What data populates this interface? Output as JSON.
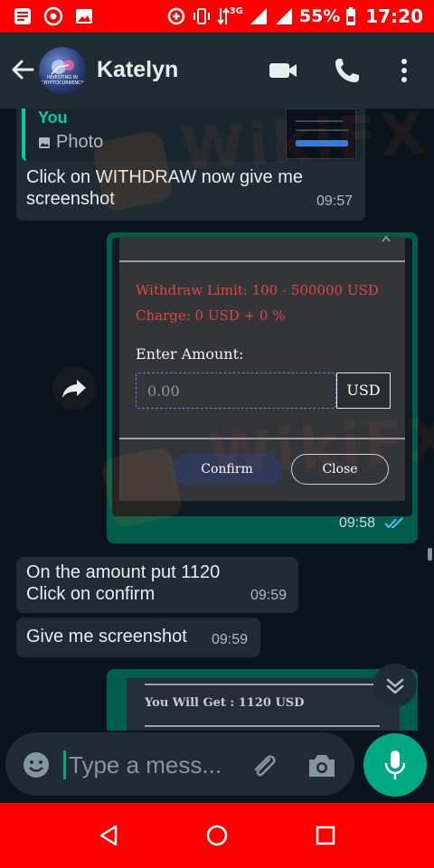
{
  "status_bar": {
    "battery": "55%",
    "network": "3G",
    "time": "17:20"
  },
  "header": {
    "contact_name": "Katelyn",
    "avatar_caption": "INVESTING IN CRYPTOCURRENCY"
  },
  "messages": {
    "quoted": {
      "author": "You",
      "type_label": "Photo"
    },
    "msg1": {
      "text": "Click on WITHDRAW now give me screenshot",
      "time": "09:57"
    },
    "screenshot1": {
      "withdraw_limit": "Withdraw Limit: 100 - 500000 USD",
      "charge": "Charge: 0 USD + 0 %",
      "enter_amount_label": "Enter Amount:",
      "amount_placeholder": "0.00",
      "currency": "USD",
      "confirm_label": "Confirm",
      "close_label": "Close",
      "time": "09:58",
      "ticks": "read-double-check-icon"
    },
    "msg2": {
      "line1": "On the amount put 1120",
      "line2": "Click on confirm",
      "time": "09:59"
    },
    "msg3": {
      "text": "Give me screenshot",
      "time": "09:59"
    },
    "screenshot2": {
      "text": "You Will Get : 1120 USD"
    }
  },
  "composer": {
    "placeholder": "Type a mess..."
  },
  "watermark": "WikiFX",
  "colors": {
    "status_bar": "#ff0000",
    "header": "#1f2c34",
    "chat_bg": "#0b141a",
    "incoming_bubble": "#202c33",
    "outgoing_bubble": "#005c4b",
    "accent": "#00a884",
    "tick_blue": "#53bdeb",
    "warning_red": "#e0473e"
  }
}
